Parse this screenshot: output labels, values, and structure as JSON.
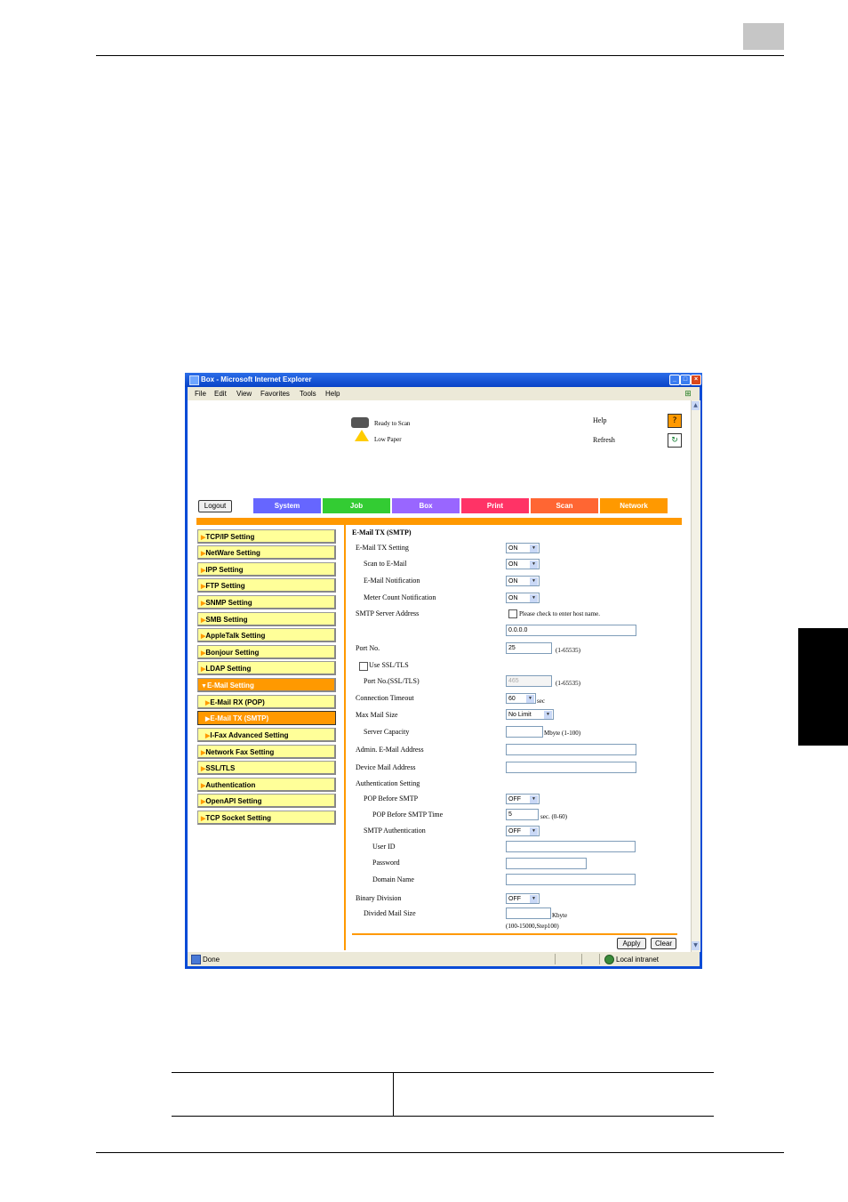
{
  "window": {
    "title": "Box - Microsoft Internet Explorer"
  },
  "menubar": [
    "File",
    "Edit",
    "View",
    "Favorites",
    "Tools",
    "Help"
  ],
  "status": {
    "ready": "Ready to Scan",
    "paper": "Low Paper",
    "help": "Help",
    "refresh": "Refresh"
  },
  "logout": "Logout",
  "tabs": [
    {
      "label": "System",
      "color": "#6666ff"
    },
    {
      "label": "Job",
      "color": "#33cc33"
    },
    {
      "label": "Box",
      "color": "#9966ff"
    },
    {
      "label": "Print",
      "color": "#ff3366"
    },
    {
      "label": "Scan",
      "color": "#ff6633"
    },
    {
      "label": "Network",
      "color": "#ff9900"
    }
  ],
  "nav": [
    "TCP/IP Setting",
    "NetWare Setting",
    "IPP Setting",
    "FTP Setting",
    "SNMP Setting",
    "SMB Setting",
    "AppleTalk Setting",
    "Bonjour Setting",
    "LDAP Setting",
    "E-Mail Setting",
    "E-Mail RX (POP)",
    "E-Mail TX (SMTP)",
    "I-Fax Advanced Setting",
    "Network Fax Setting",
    "SSL/TLS",
    "Authentication",
    "OpenAPI Setting",
    "TCP Socket Setting"
  ],
  "form": {
    "heading": "E-Mail TX (SMTP)",
    "tx_setting": {
      "label": "E-Mail TX Setting",
      "value": "ON"
    },
    "scan_to_email": {
      "label": "Scan to E-Mail",
      "value": "ON"
    },
    "email_notification": {
      "label": "E-Mail Notification",
      "value": "ON"
    },
    "meter_count": {
      "label": "Meter Count Notification",
      "value": "ON"
    },
    "smtp_server": {
      "label": "SMTP Server Address",
      "check_label": "Please check to enter host name.",
      "value": "0.0.0.0"
    },
    "port": {
      "label": "Port No.",
      "value": "25",
      "hint": "(1-65535)"
    },
    "use_ssl": {
      "label": "Use SSL/TLS"
    },
    "ssl_port": {
      "label": "Port No.(SSL/TLS)",
      "value": "465",
      "hint": "(1-65535)"
    },
    "timeout": {
      "label": "Connection Timeout",
      "value": "60",
      "unit": "sec"
    },
    "max_mail": {
      "label": "Max Mail Size",
      "value": "No Limit"
    },
    "server_capacity": {
      "label": "Server Capacity",
      "unit": "Mbyte (1-100)"
    },
    "admin_email": {
      "label": "Admin. E-Mail Address"
    },
    "device_mail": {
      "label": "Device Mail Address"
    },
    "auth_setting": {
      "label": "Authentication Setting"
    },
    "pop_before": {
      "label": "POP Before SMTP",
      "value": "OFF"
    },
    "pop_time": {
      "label": "POP Before SMTP Time",
      "value": "5",
      "unit": "sec. (0-60)"
    },
    "smtp_auth": {
      "label": "SMTP Authentication",
      "value": "OFF"
    },
    "user_id": {
      "label": "User ID"
    },
    "password": {
      "label": "Password"
    },
    "domain": {
      "label": "Domain Name"
    },
    "binary": {
      "label": "Binary Division",
      "value": "OFF"
    },
    "divided": {
      "label": "Divided Mail Size",
      "unit": "Kbyte",
      "range": "(100-15000,Step100)"
    },
    "apply": "Apply",
    "clear": "Clear"
  },
  "statusbar": {
    "text": "Done",
    "zone": "Local intranet"
  }
}
